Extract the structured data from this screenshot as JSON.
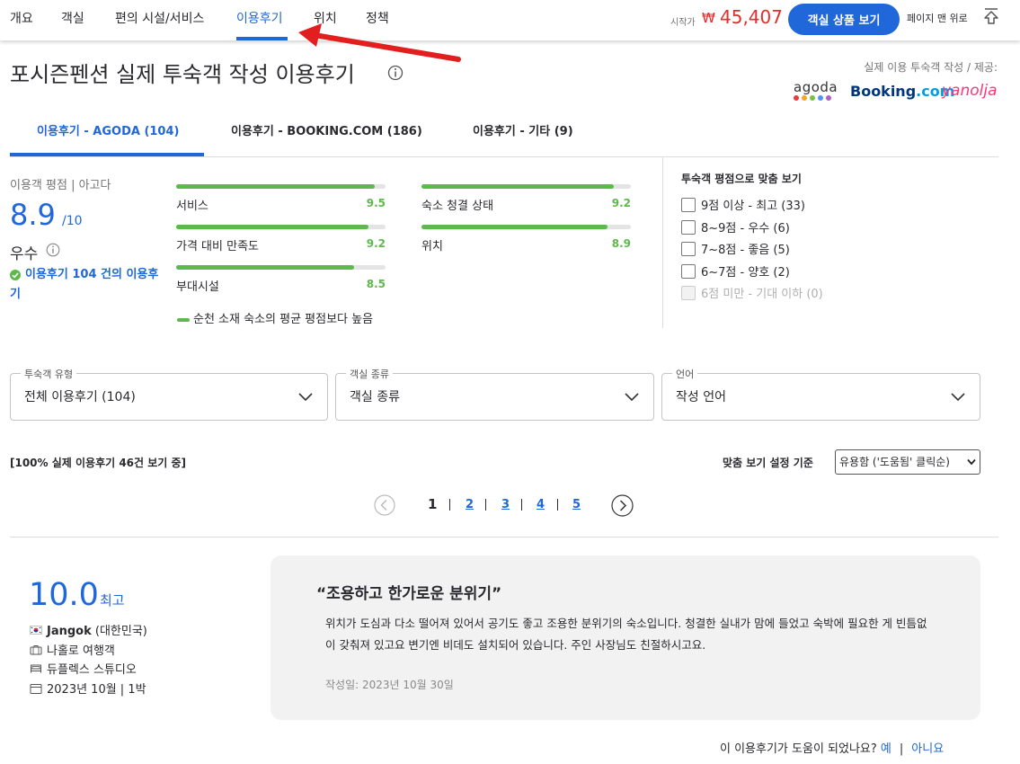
{
  "topnav": {
    "tabs": [
      "개요",
      "객실",
      "편의 시설/서비스",
      "이용후기",
      "위치",
      "정책"
    ],
    "active_tab": "이용후기",
    "price_label": "시작가",
    "currency": "₩",
    "price": "45,407",
    "book_button": "객실 상품 보기",
    "to_top": "페이지 맨 위로"
  },
  "header": {
    "title": "포시즌펜션 실제 투숙객 작성 이용후기",
    "provider_label": "실제 이용 투숙객 작성 / 제공:",
    "logos": {
      "agoda": "agoda",
      "booking_main": "Booking",
      "booking_suffix": ".com",
      "yanolja": "yanolja"
    },
    "agoda_dot_colors": [
      "#e93b3b",
      "#f5a623",
      "#7ac143",
      "#5392f9",
      "#b25fc3"
    ]
  },
  "source_tabs": [
    {
      "label": "이용후기 - AGODA (104)",
      "active": true
    },
    {
      "label": "이용후기 - BOOKING.COM (186)",
      "active": false
    },
    {
      "label": "이용후기 - 기타 (9)",
      "active": false
    }
  ],
  "summary": {
    "title": "이용객 평점 | 아고다",
    "score": "8.9",
    "score_max": "/10",
    "word": "우수",
    "review_count_link": "이용후기 104 건의 이용후기"
  },
  "categories": [
    {
      "label": "서비스",
      "value": "9.5"
    },
    {
      "label": "숙소 청결 상태",
      "value": "9.2"
    },
    {
      "label": "가격 대비 만족도",
      "value": "9.2"
    },
    {
      "label": "위치",
      "value": "8.9"
    },
    {
      "label": "부대시설",
      "value": "8.5"
    }
  ],
  "compare_note": "순천 소재 숙소의 평균 평점보다 높음",
  "score_filter": {
    "title": "투숙객 평점으로 맞춤 보기",
    "options": [
      {
        "label": "9점 이상 - 최고 (33)",
        "disabled": false
      },
      {
        "label": "8~9점 - 우수 (6)",
        "disabled": false
      },
      {
        "label": "7~8점 - 좋음 (5)",
        "disabled": false
      },
      {
        "label": "6~7점 - 양호 (2)",
        "disabled": false
      },
      {
        "label": "6점 미만 - 기대 이하 (0)",
        "disabled": true
      }
    ]
  },
  "dropdowns": [
    {
      "legend": "투숙객 유형",
      "value": "전체 이용후기 (104)"
    },
    {
      "legend": "객실 종류",
      "value": "객실 종류"
    },
    {
      "legend": "언어",
      "value": "작성 언어"
    }
  ],
  "list": {
    "count_note": "[100% 실제 이용후기 46건 보기 중]",
    "sort_label": "맞춤 보기 설정 기준",
    "sort_value": "유용함 ('도움됨' 클릭순)"
  },
  "pagination": {
    "current": "1",
    "pages": [
      "2",
      "3",
      "4",
      "5"
    ]
  },
  "review": {
    "score": "10.0",
    "word": "최고",
    "reviewer_name": "Jangok",
    "reviewer_country": " (대한민국)",
    "traveler_type": "나홀로 여행객",
    "room_type": "듀플렉스 스튜디오",
    "stay": "2023년 10월 | 1박",
    "title": "“조용하고 한가로운 분위기”",
    "body": "위치가 도심과 다소 떨어져 있어서 공기도 좋고 조용한 분위기의 숙소입니다. 청결한 실내가 맘에 들었고 숙박에 필요한 게 빈틈없이 갖춰져 있고요 변기엔 비데도 설치되어 있습니다. 주인 사장님도 친절하시고요.",
    "date": "작성일: 2023년 10월 30일"
  },
  "helpful": {
    "question": "이 이용후기가 도움이 되었나요?",
    "yes": "예",
    "separator": "|",
    "no": "아니요"
  },
  "colors": {
    "accent": "#2067da",
    "price": "#e12d2d",
    "score_bar": "#5eb94c",
    "annotation_arrow": "#e31e1e"
  }
}
